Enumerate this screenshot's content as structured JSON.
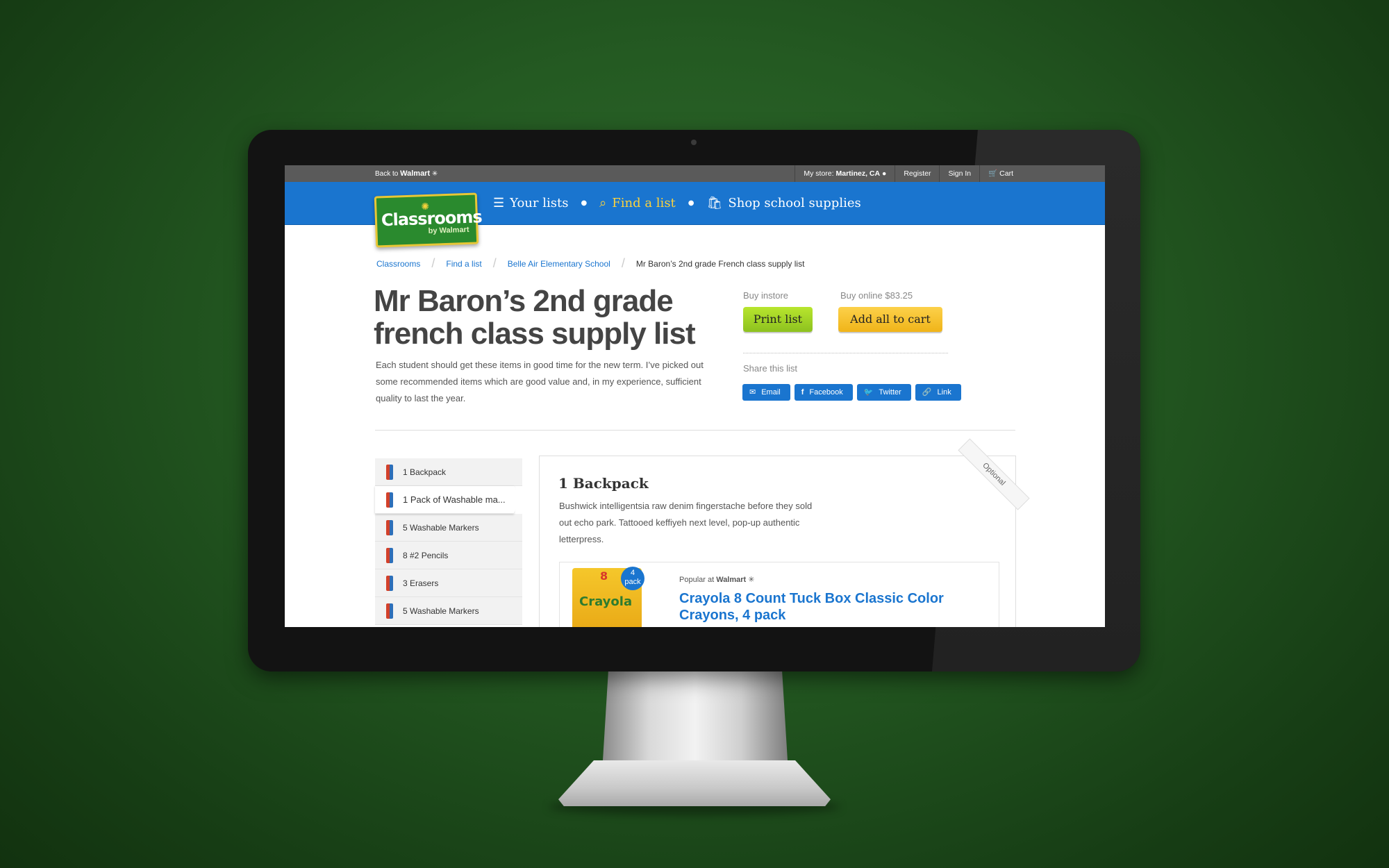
{
  "topbar": {
    "back_prefix": "Back to",
    "back_brand": "Walmart",
    "store_label": "My store:",
    "store_value": "Martinez, CA",
    "register": "Register",
    "sign_in": "Sign In",
    "cart": "Cart"
  },
  "logo": {
    "main": "Classrooms",
    "sub": "by Walmart"
  },
  "nav": {
    "your_lists": "Your lists",
    "find_a_list": "Find a list",
    "shop": "Shop school supplies"
  },
  "breadcrumb": [
    "Classrooms",
    "Find a list",
    "Belle Air Elementary School",
    "Mr Baron’s 2nd grade French class supply list"
  ],
  "page": {
    "title": "Mr Baron’s 2nd grade french class supply list",
    "description": "Each student should get these items in good time for the new term. I’ve picked out some recommended items which are good value and, in my experience, sufficient quality to last the year."
  },
  "buy": {
    "instore_label": "Buy instore",
    "online_label": "Buy online",
    "online_price": "$83.25",
    "print_button": "Print list",
    "add_all_button": "Add all to cart"
  },
  "share": {
    "label": "Share this list",
    "email": "Email",
    "facebook": "Facebook",
    "twitter": "Twitter",
    "link": "Link"
  },
  "items": [
    "1 Backpack",
    "1 Pack of Washable ma...",
    "5 Washable Markers",
    "8 #2 Pencils",
    "3 Erasers",
    "5 Washable Markers"
  ],
  "detail": {
    "heading": "1 Backpack",
    "ribbon": "Optional",
    "description": "Bushwick intelligentsia raw denim fingerstache before they sold out echo park. Tattooed keffiyeh next level, pop-up authentic letterpress.",
    "popular_prefix": "Popular at",
    "popular_brand": "Walmart",
    "product_title": "Crayola 8 Count Tuck Box Classic Color Crayons, 4 pack",
    "badge_num": "4",
    "badge_unit": "pack",
    "box_brand": "Crayola",
    "box_count": "8"
  },
  "colors": {
    "blue": "#1a75cf",
    "green_btn": "#9fd424",
    "yellow_btn": "#f6c230",
    "background": "#245a22"
  }
}
